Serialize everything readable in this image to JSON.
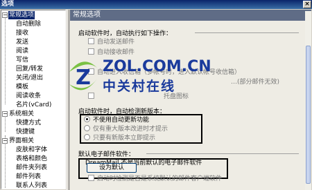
{
  "window": {
    "title": "选项",
    "close_glyph": "×"
  },
  "tree": {
    "items": [
      {
        "label": "常规选项",
        "level": 0,
        "expanded": true,
        "selected": true
      },
      {
        "label": "自动删除",
        "level": 1
      },
      {
        "label": "接收",
        "level": 1
      },
      {
        "label": "发送",
        "level": 1
      },
      {
        "label": "阅读",
        "level": 1
      },
      {
        "label": "写信",
        "level": 1
      },
      {
        "label": "回复/转发",
        "level": 1
      },
      {
        "label": "关闭/退出",
        "level": 1
      },
      {
        "label": "模板",
        "level": 1
      },
      {
        "label": "阅读收条",
        "level": 1
      },
      {
        "label": "名片(vCard)",
        "level": 1
      },
      {
        "label": "系统相关",
        "level": 0,
        "expanded": true
      },
      {
        "label": "快捷方式",
        "level": 1
      },
      {
        "label": "快捷键",
        "level": 1
      },
      {
        "label": "界面相关",
        "level": 0,
        "expanded": true
      },
      {
        "label": "皮肤和字体",
        "level": 1
      },
      {
        "label": "表格和颜色",
        "level": 1
      },
      {
        "label": "邮件夹列表",
        "level": 1
      },
      {
        "label": "邮件列表",
        "level": 1
      },
      {
        "label": "联系人列表",
        "level": 1
      }
    ],
    "toggle_minus": "−"
  },
  "pane": {
    "header": "常规选项",
    "startup": {
      "title": "启动软件时，自动执行如下操作：",
      "options": [
        "自动发送邮件",
        "自动接收邮件",
        "自动进入收信箱（多帐号时，进入默认帐号收信箱）",
        "…(部分邮件无效)"
      ],
      "tray_option": "托盘图标"
    },
    "update": {
      "title": "启动软件时，自动检测新版本：",
      "options": [
        {
          "label": "不使用自动更新功能",
          "checked": true
        },
        {
          "label": "仅有重大版本改进时才提示",
          "checked": false
        },
        {
          "label": "只要有新版本立即提示",
          "checked": false
        }
      ]
    },
    "default_client": {
      "title": "默认电子邮件软件：",
      "status": "DreamMail 不是当前默认的电子邮件软件",
      "set_default_button": "设为默认",
      "check_option": "启动时检测是否是系统默认的邮件客户端软件"
    }
  },
  "watermark": {
    "line1": "ZOL.COM.CN",
    "line2": "中关村在线",
    "logo_letter": "Z"
  },
  "colors": {
    "header": "#5f6c86",
    "selection": "#0a246a",
    "title_gradient_start": "#0a246a",
    "logo_blue": "#1a3a9c",
    "logo_green": "#7ac143"
  }
}
